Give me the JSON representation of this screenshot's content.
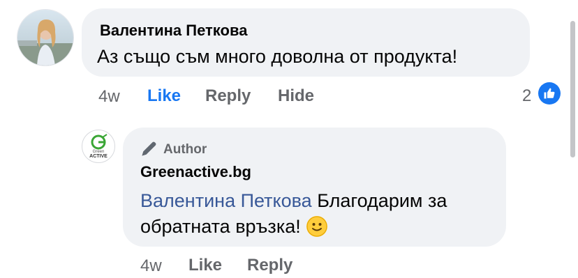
{
  "comment": {
    "author": "Валентина Петкова",
    "text": "Аз също съм много доволна от продукта!",
    "time": "4w",
    "actions": {
      "like": "Like",
      "reply": "Reply",
      "hide": "Hide"
    },
    "reaction_count": "2",
    "reaction_icon": "like-thumb-icon"
  },
  "reply": {
    "badge": "Author",
    "author": "Greenactive.bg",
    "mention": "Валентина Петкова",
    "text": "Благодарим за обратната връзка!",
    "emoji": "slightly-smiling-face",
    "time": "4w",
    "actions": {
      "like": "Like",
      "reply": "Reply"
    },
    "avatar_logo": {
      "top": "Green",
      "bottom": "ACTIVE"
    }
  },
  "colors": {
    "bubble": "#f0f2f5",
    "link_blue": "#1877f2",
    "mention_blue": "#385898",
    "meta_gray": "#65676b"
  }
}
